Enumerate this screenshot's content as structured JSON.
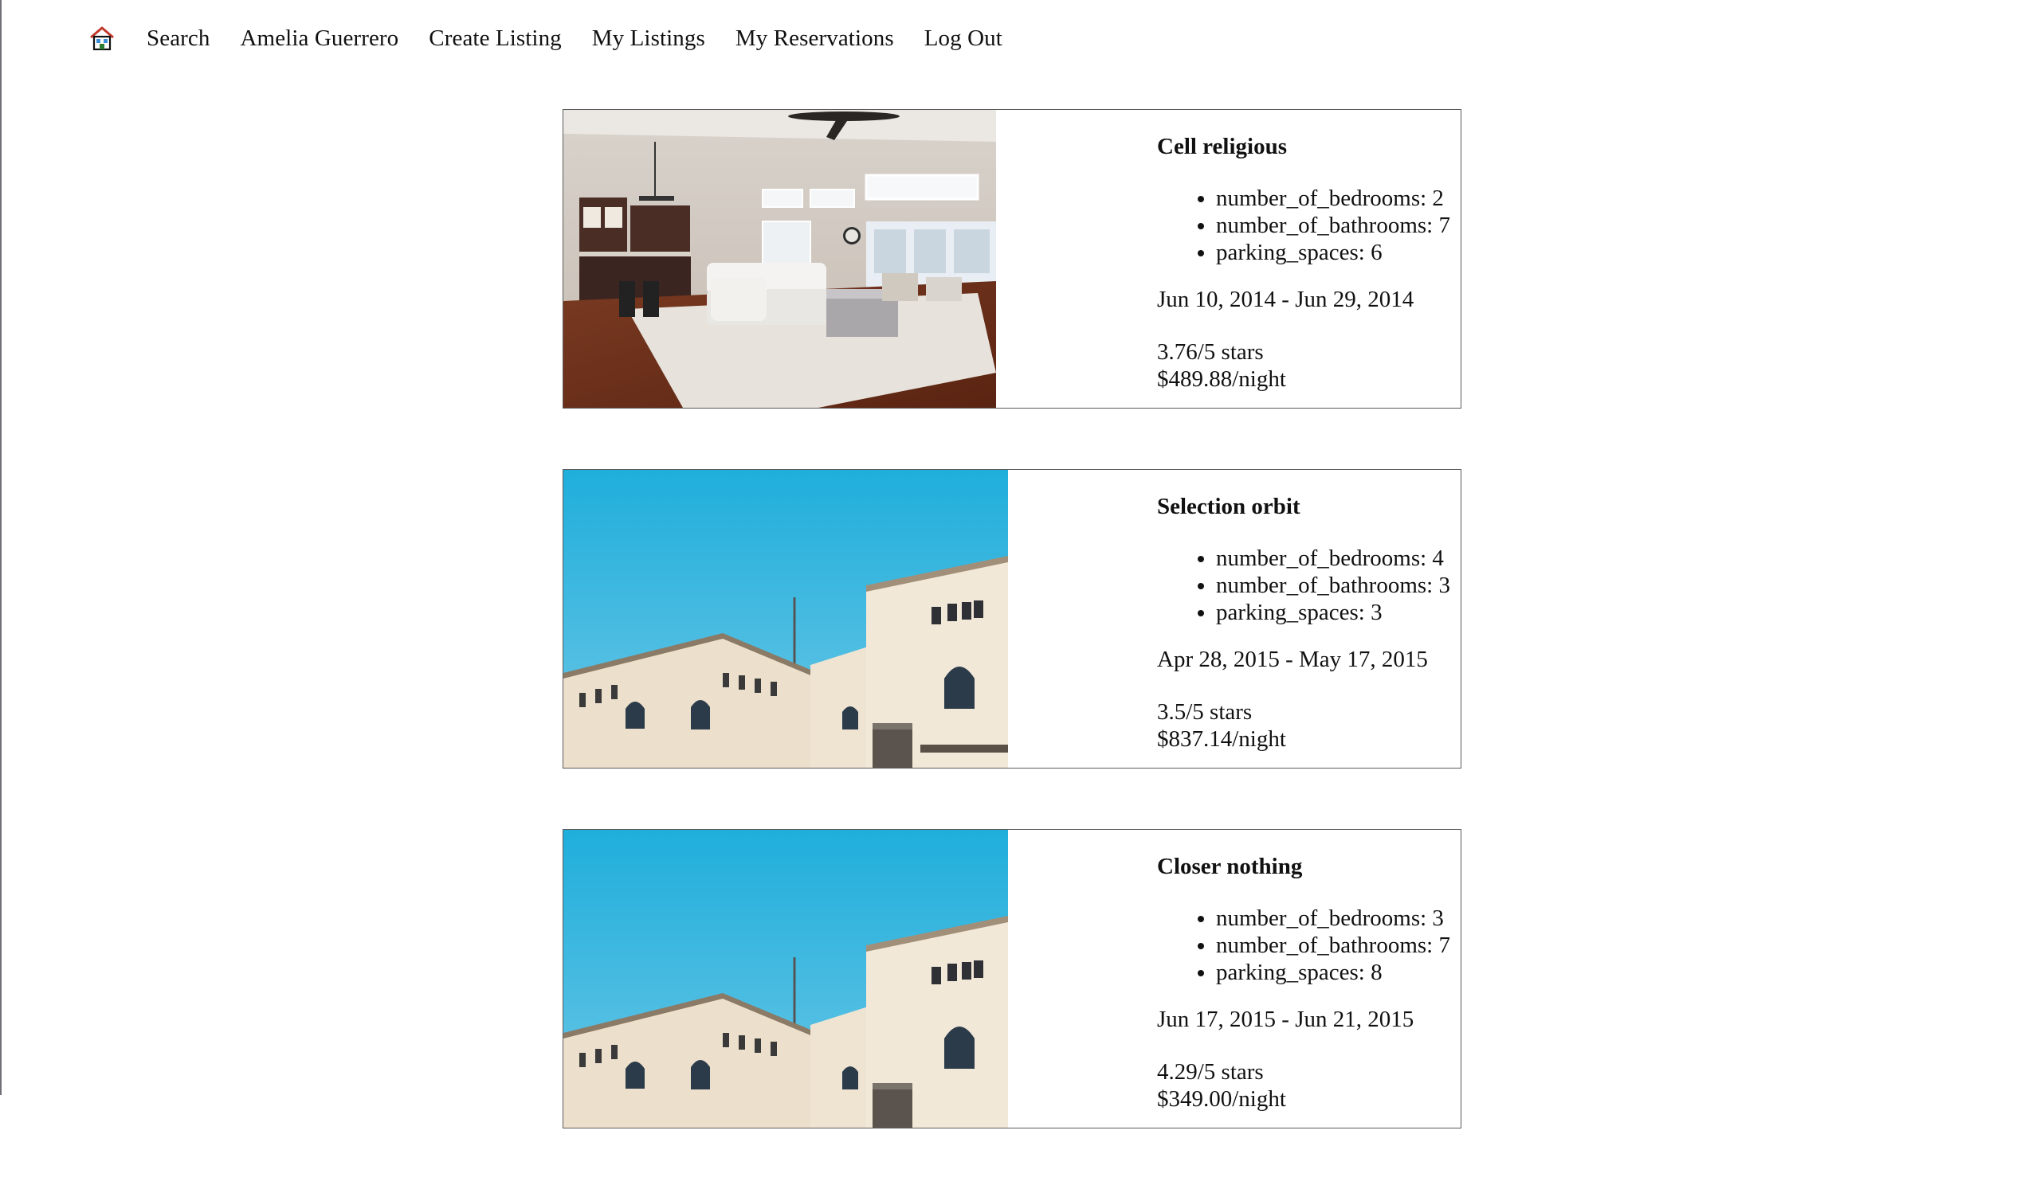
{
  "nav": {
    "home_icon": "home-icon",
    "links": [
      {
        "label": "Search"
      },
      {
        "label": "Amelia Guerrero"
      },
      {
        "label": "Create Listing"
      },
      {
        "label": "My Listings"
      },
      {
        "label": "My Reservations"
      },
      {
        "label": "Log Out"
      }
    ]
  },
  "listings": [
    {
      "title": "Cell religious",
      "photo": "living-room-photo",
      "details": [
        "number_of_bedrooms: 2",
        "number_of_bathrooms: 7",
        "parking_spaces: 6"
      ],
      "dates": "Jun 10, 2014 - Jun 29, 2014",
      "rating": "3.76/5 stars",
      "price": "$489.88/night"
    },
    {
      "title": "Selection orbit",
      "photo": "building-exterior-photo",
      "details": [
        "number_of_bedrooms: 4",
        "number_of_bathrooms: 3",
        "parking_spaces: 3"
      ],
      "dates": "Apr 28, 2015 - May 17, 2015",
      "rating": "3.5/5 stars",
      "price": "$837.14/night"
    },
    {
      "title": "Closer nothing",
      "photo": "building-exterior-photo",
      "details": [
        "number_of_bedrooms: 3",
        "number_of_bathrooms: 7",
        "parking_spaces: 8"
      ],
      "dates": "Jun 17, 2015 - Jun 21, 2015",
      "rating": "4.29/5 stars",
      "price": "$349.00/night"
    }
  ]
}
